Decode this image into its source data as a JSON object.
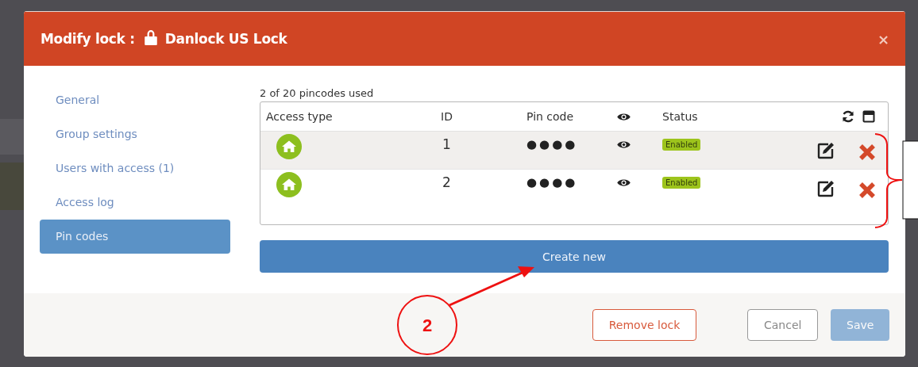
{
  "dialog": {
    "title_prefix": "Modify lock :",
    "lock_name": "Danlock US Lock",
    "close": "×"
  },
  "sidebar": {
    "items": [
      {
        "label": "General",
        "selected": false
      },
      {
        "label": "Group settings",
        "selected": false
      },
      {
        "label": "Users with access (1)",
        "selected": false
      },
      {
        "label": "Access log",
        "selected": false
      },
      {
        "label": "Pin codes",
        "selected": true
      }
    ]
  },
  "usage": "2 of 20 pincodes used",
  "table": {
    "columns": [
      "Access type",
      "ID",
      "Pin code",
      "Status"
    ],
    "rows": [
      {
        "id": "1",
        "pin": "●●●●",
        "status": "Enabled"
      },
      {
        "id": "2",
        "pin": "●●●●",
        "status": "Enabled"
      }
    ]
  },
  "create_button": "Create new",
  "footer": {
    "buttons": [
      {
        "label": "Remove lock",
        "kind": "danger",
        "disabled": false
      },
      {
        "label": "Cancel",
        "kind": "default",
        "disabled": false
      },
      {
        "label": "Save",
        "kind": "primary",
        "disabled": true
      }
    ]
  },
  "annotation": {
    "number": "2"
  }
}
